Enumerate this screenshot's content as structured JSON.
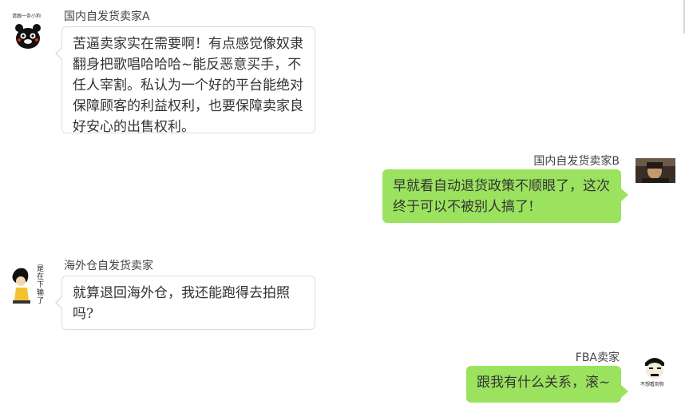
{
  "messages": [
    {
      "sender": "国内自发货卖家A",
      "text": "苦逼卖家实在需要啊！有点感觉像奴隶翻身把歌唱哈哈哈~能反恶意买手，不任人宰割。私认为一个好的平台能绝对保障顾客的利益权利，也要保障卖家良好安心的出售权利。",
      "avatar_icon": "bear-mascot-avatar",
      "avatar_caption": "请跟一条小狗"
    },
    {
      "sender": "国内自发货卖家B",
      "text": "早就看自动退货政策不顺眼了，这次终于可以不被别人搞了!",
      "avatar_icon": "photo-avatar"
    },
    {
      "sender": "海外仓自发货卖家",
      "text": "就算退回海外仓，我还能跑得去拍照吗?",
      "avatar_icon": "cartoon-girl-avatar",
      "avatar_caption": "是在下输了"
    },
    {
      "sender": "FBA卖家",
      "text": "跟我有什么关系，滚~",
      "avatar_icon": "cartoon-face-avatar",
      "avatar_caption": "不想看到你"
    }
  ],
  "colors": {
    "right_bubble": "#9be35e",
    "left_bubble": "#ffffff",
    "left_border": "#dcdcdc"
  }
}
